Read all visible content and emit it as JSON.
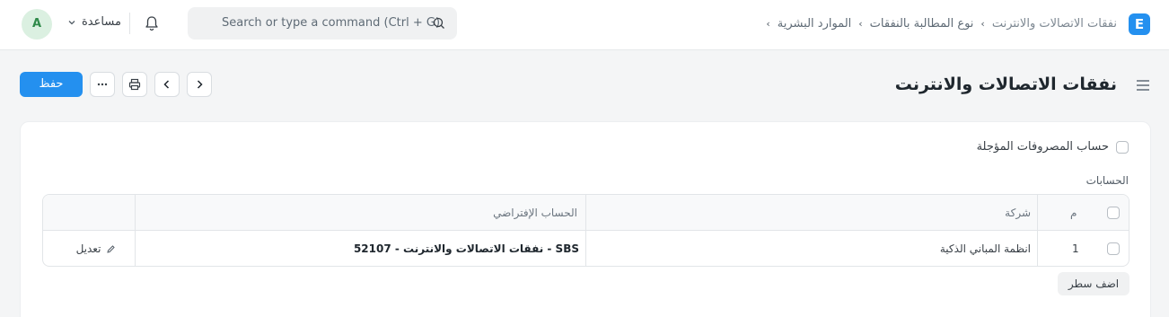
{
  "app": {
    "logo_letter": "E"
  },
  "breadcrumb": [
    "الموارد البشرية",
    "نوع المطالبة بالنفقات",
    "نفقات الاتصالات والانترنت"
  ],
  "search": {
    "placeholder": "Search or type a command (Ctrl + G)"
  },
  "navbar": {
    "help_label": "مساعدة",
    "avatar_letter": "A"
  },
  "page": {
    "title": "نفقات الاتصالات والانترنت",
    "save_label": "حفظ"
  },
  "form": {
    "deferred_checkbox_label": "حساب المصروفات المؤجلة",
    "deferred_checked": false,
    "accounts_section_label": "الحسابات"
  },
  "table": {
    "headers": {
      "index": "م",
      "company": "شركة",
      "default_account": "الحساب الإفتراضي"
    },
    "rows": [
      {
        "index": "1",
        "company": "انظمة المباني الذكية",
        "default_account": "52107 - نفقات الاتصالات والانترنت - SBS",
        "edit_label": "تعديل"
      }
    ],
    "add_row_label": "اضف سطر"
  },
  "colors": {
    "primary": "#2490ef",
    "avatar_bg": "#dbf0e1",
    "avatar_fg": "#2f8a4a"
  }
}
